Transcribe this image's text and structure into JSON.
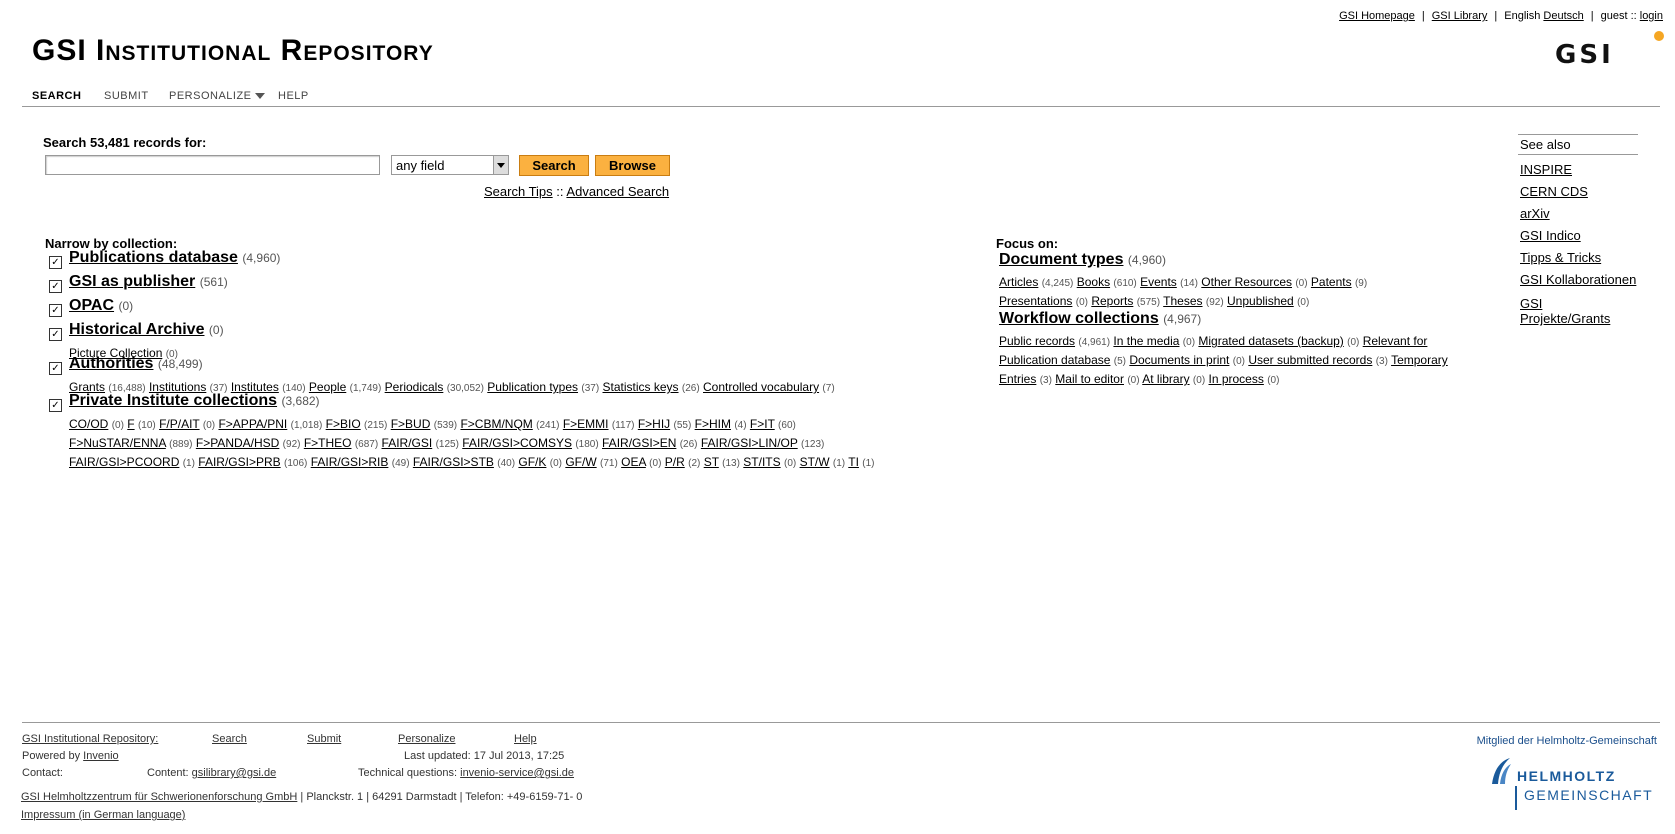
{
  "top_links": {
    "homepage": "GSI Homepage",
    "library": "GSI Library",
    "lang_current": "English",
    "lang_other": "Deutsch",
    "guest": "guest ::",
    "login": "login"
  },
  "site_title": "GSI Institutional Repository",
  "logo_text": "GSI",
  "nav": {
    "search": "SEARCH",
    "submit": "SUBMIT",
    "personalize": "PERSONALIZE",
    "help": "HELP"
  },
  "search": {
    "label": "Search 53,481 records for:",
    "value": "",
    "field": "any field",
    "search_button": "Search",
    "browse_button": "Browse",
    "tips": "Search Tips",
    "sep": "::",
    "advanced": "Advanced Search"
  },
  "narrow_title": "Narrow by collection:",
  "focus_title": "Focus on:",
  "collections": [
    {
      "name": "Publications database",
      "count": "(4,960)",
      "checked": true,
      "subs": []
    },
    {
      "name": "GSI as publisher",
      "count": "(561)",
      "checked": true,
      "subs": []
    },
    {
      "name": "OPAC",
      "count": "(0)",
      "checked": true,
      "subs": []
    },
    {
      "name": "Historical Archive",
      "count": "(0)",
      "checked": true,
      "subs": [
        [
          {
            "name": "Picture Collection",
            "count": "(0)"
          }
        ]
      ]
    },
    {
      "name": "Authorities",
      "count": "(48,499)",
      "checked": true,
      "subs": [
        [
          {
            "name": "Grants",
            "count": "(16,488)"
          },
          {
            "name": "Institutions",
            "count": "(37)"
          },
          {
            "name": "Institutes",
            "count": "(140)"
          },
          {
            "name": "People",
            "count": "(1,749)"
          },
          {
            "name": "Periodicals",
            "count": "(30,052)"
          },
          {
            "name": "Publication types",
            "count": "(37)"
          },
          {
            "name": "Statistics keys",
            "count": "(26)"
          },
          {
            "name": "Controlled vocabulary",
            "count": "(7)"
          }
        ]
      ]
    },
    {
      "name": "Private Institute collections",
      "count": "(3,682)",
      "checked": true,
      "subs": [
        [
          {
            "name": "CO/OD",
            "count": "(0)"
          },
          {
            "name": "F",
            "count": "(10)"
          },
          {
            "name": "F/P/AIT",
            "count": "(0)"
          },
          {
            "name": "F>APPA/PNI",
            "count": "(1,018)"
          },
          {
            "name": "F>BIO",
            "count": "(215)"
          },
          {
            "name": "F>BUD",
            "count": "(539)"
          },
          {
            "name": "F>CBM/NQM",
            "count": "(241)"
          },
          {
            "name": "F>EMMI",
            "count": "(117)"
          },
          {
            "name": "F>HIJ",
            "count": "(55)"
          },
          {
            "name": "F>HIM",
            "count": "(4)"
          },
          {
            "name": "F>IT",
            "count": "(60)"
          }
        ],
        [
          {
            "name": "F>NuSTAR/ENNA",
            "count": "(889)"
          },
          {
            "name": "F>PANDA/HSD",
            "count": "(92)"
          },
          {
            "name": "F>THEO",
            "count": "(687)"
          },
          {
            "name": "FAIR/GSI",
            "count": "(125)"
          },
          {
            "name": "FAIR/GSI>COMSYS",
            "count": "(180)"
          },
          {
            "name": "FAIR/GSI>EN",
            "count": "(26)"
          },
          {
            "name": "FAIR/GSI>LIN/OP",
            "count": "(123)"
          }
        ],
        [
          {
            "name": "FAIR/GSI>PCOORD",
            "count": "(1)"
          },
          {
            "name": "FAIR/GSI>PRB",
            "count": "(106)"
          },
          {
            "name": "FAIR/GSI>RIB",
            "count": "(49)"
          },
          {
            "name": "FAIR/GSI>STB",
            "count": "(40)"
          },
          {
            "name": "GF/K",
            "count": "(0)"
          },
          {
            "name": "GF/W",
            "count": "(71)"
          },
          {
            "name": "OEA",
            "count": "(0)"
          },
          {
            "name": "P/R",
            "count": "(2)"
          },
          {
            "name": "ST",
            "count": "(13)"
          },
          {
            "name": "ST/ITS",
            "count": "(0)"
          },
          {
            "name": "ST/W",
            "count": "(1)"
          },
          {
            "name": "TI",
            "count": "(1)"
          }
        ]
      ]
    }
  ],
  "focus": [
    {
      "name": "Document types",
      "count": "(4,960)",
      "subs": [
        [
          {
            "name": "Articles",
            "count": "(4,245)"
          },
          {
            "name": "Books",
            "count": "(610)"
          },
          {
            "name": "Events",
            "count": "(14)"
          },
          {
            "name": "Other Resources",
            "count": "(0)"
          },
          {
            "name": "Patents",
            "count": "(9)"
          }
        ],
        [
          {
            "name": "Presentations",
            "count": "(0)"
          },
          {
            "name": "Reports",
            "count": "(575)"
          },
          {
            "name": "Theses",
            "count": "(92)"
          },
          {
            "name": "Unpublished",
            "count": "(0)"
          }
        ]
      ]
    },
    {
      "name": "Workflow collections",
      "count": "(4,967)",
      "subs": [
        [
          {
            "name": "Public records",
            "count": "(4,961)"
          },
          {
            "name": "In the media",
            "count": "(0)"
          },
          {
            "name": "Migrated datasets (backup)",
            "count": "(0)"
          },
          {
            "name": "Relevant for",
            "count": ""
          }
        ],
        [
          {
            "name": "Publication database",
            "count": "(5)"
          },
          {
            "name": "Documents in print",
            "count": "(0)"
          },
          {
            "name": "User submitted records",
            "count": "(3)"
          },
          {
            "name": "Temporary",
            "count": ""
          }
        ],
        [
          {
            "name": "Entries",
            "count": "(3)"
          },
          {
            "name": "Mail to editor",
            "count": "(0)"
          },
          {
            "name": "At library",
            "count": "(0)"
          },
          {
            "name": "In process",
            "count": "(0)"
          }
        ]
      ]
    }
  ],
  "see_also": {
    "title": "See also",
    "links": [
      "INSPIRE",
      "CERN CDS",
      "arXiv",
      "GSI Indico",
      "Tipps & Tricks",
      "GSI Kollaborationen",
      "GSI",
      "Projekte/Grants"
    ]
  },
  "footer": {
    "repo": "GSI Institutional Repository:",
    "search": "Search",
    "submit": "Submit",
    "personalize": "Personalize",
    "help": "Help",
    "powered": "Powered by",
    "invenio": "Invenio",
    "updated": "Last updated: 17 Jul 2013, 17:25",
    "contact": "Contact:",
    "content_label": "Content:",
    "content_email": "gsilibrary@gsi.de",
    "tech_label": "Technical questions:",
    "tech_email": "invenio-service@gsi.de",
    "org_link": "GSI Helmholtzzentrum für Schwerionenforschung GmbH",
    "org_address": "| Planckstr. 1 | 64291 Darmstadt | Telefon: +49-6159-71- 0",
    "impressum": "Impressum (in German language)",
    "helmholtz_member": "Mitglied der Helmholtz-Gemeinschaft",
    "helmholtz_1": "HELMHOLTZ",
    "helmholtz_2": "GEMEINSCHAFT"
  },
  "colors": {
    "button": "#fbb140",
    "logo_dot": "#f5a623",
    "helmholtz": "#1a5a9b"
  }
}
